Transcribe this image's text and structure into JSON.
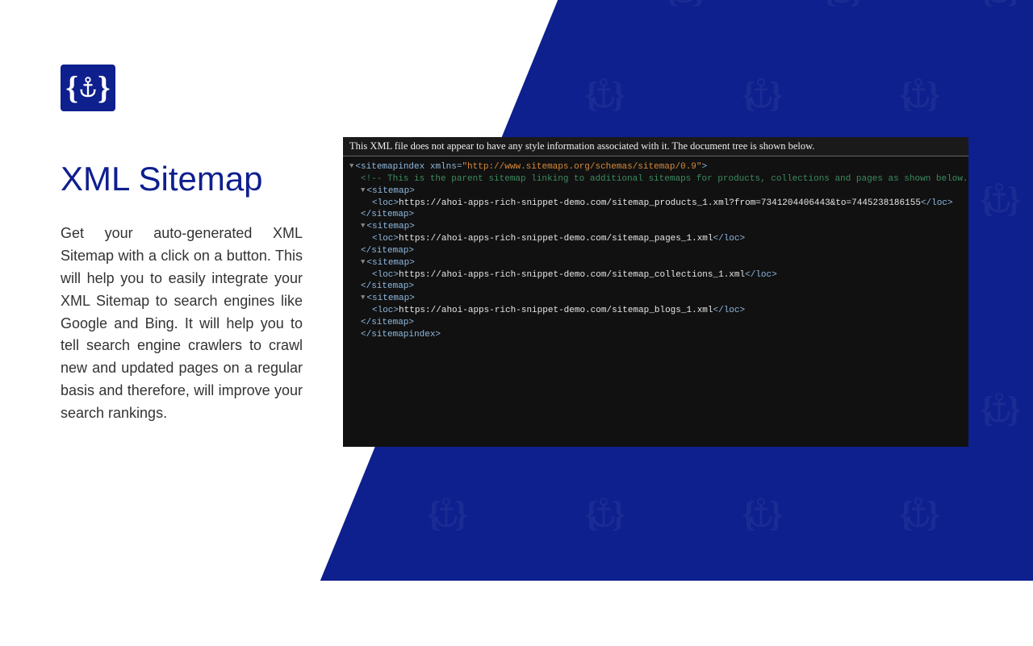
{
  "title": "XML Sitemap",
  "description": "Get your auto-generated XML Sitemap with a click on a button. This will help you to easily integrate your XML Sitemap to search engines like Google and Bing. It will help you to tell search engine crawlers to crawl new and updated pages on a regular basis and therefore, will improve your search rankings.",
  "terminal": {
    "header": "This XML file does not appear to have any style information associated with it. The document tree is shown below.",
    "xmlns": "http://www.sitemaps.org/schemas/sitemap/0.9",
    "comment": "<!-- This is the parent sitemap linking to additional sitemaps for products, collections and pages as shown below. The sitemap can not be edited manua",
    "sitemaps": [
      "https://ahoi-apps-rich-snippet-demo.com/sitemap_products_1.xml?from=7341204406443&to=7445238186155",
      "https://ahoi-apps-rich-snippet-demo.com/sitemap_pages_1.xml",
      "https://ahoi-apps-rich-snippet-demo.com/sitemap_collections_1.xml",
      "https://ahoi-apps-rich-snippet-demo.com/sitemap_blogs_1.xml"
    ]
  },
  "colors": {
    "brand": "#0e1f8e",
    "terminal_bg": "#111111"
  }
}
